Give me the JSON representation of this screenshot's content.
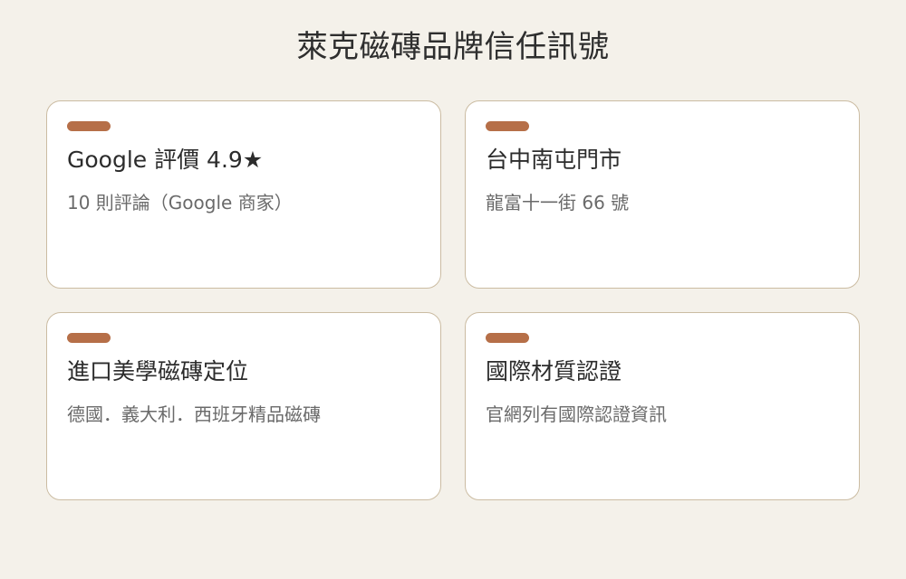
{
  "page": {
    "title": "萊克磁磚品牌信任訊號"
  },
  "cards": [
    {
      "heading": "Google 評價 4.9★",
      "subtext": "10 則評論（Google 商家）"
    },
    {
      "heading": "台中南屯門市",
      "subtext": "龍富十一街 66 號"
    },
    {
      "heading": "進口美學磁磚定位",
      "subtext": "德國．義大利．西班牙精品磁磚"
    },
    {
      "heading": "國際材質認證",
      "subtext": "官網列有國際認證資訊"
    }
  ],
  "colors": {
    "background": "#f4f1ea",
    "card_border": "#cbbca2",
    "accent": "#b66f48",
    "heading": "#2c2c2c",
    "subtext": "#6a6a6a"
  }
}
